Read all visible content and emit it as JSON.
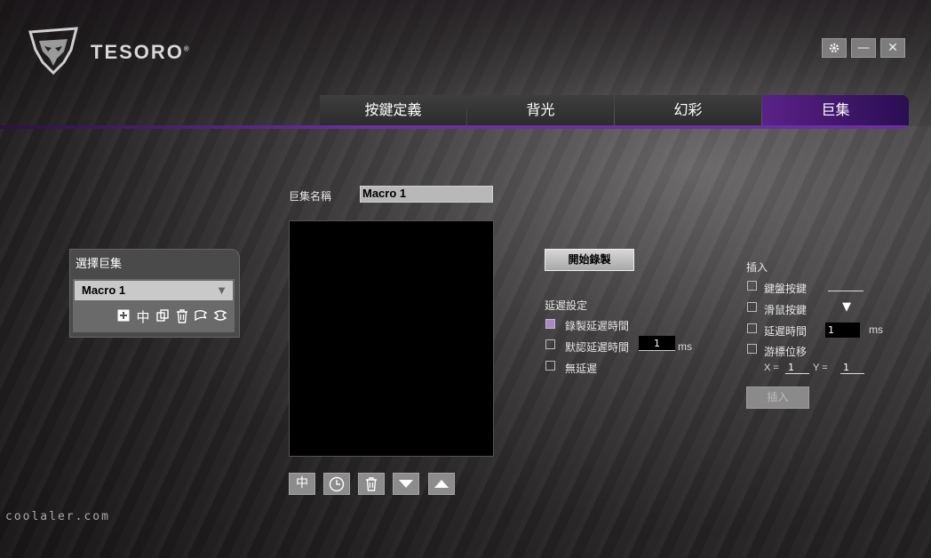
{
  "brand": {
    "name": "TESORO",
    "mark": "®"
  },
  "window": {
    "settings_icon": "gear-icon",
    "minimize_label": "—",
    "close_label": "✕"
  },
  "tabs": [
    {
      "label": "按鍵定義",
      "active": false
    },
    {
      "label": "背光",
      "active": false
    },
    {
      "label": "幻彩",
      "active": false
    },
    {
      "label": "巨集",
      "active": true
    }
  ],
  "colors": {
    "accent": "#6b2fa3",
    "active_tab": "#5a2288",
    "checkbox_checked": "#a88ac2"
  },
  "macro": {
    "name_label": "巨集名稱",
    "name_value": "Macro 1"
  },
  "select_macro": {
    "title": "選擇巨集",
    "selected": "Macro 1",
    "actions": [
      "add-icon",
      "split-icon",
      "copy-icon",
      "trash-icon",
      "import-icon",
      "export-icon"
    ]
  },
  "toolbar": {
    "buttons": [
      "split-icon",
      "clock-icon",
      "trash-icon",
      "move-down-icon",
      "move-up-icon"
    ]
  },
  "record": {
    "button_label": "開始錄製"
  },
  "delay": {
    "title": "延遲設定",
    "options": [
      {
        "label": "錄製延遲時間",
        "checked": true
      },
      {
        "label": "默認延遲時間",
        "checked": false,
        "value": "1",
        "unit": "ms"
      },
      {
        "label": "無延遲",
        "checked": false
      }
    ]
  },
  "insert": {
    "title": "插入",
    "keyboard_label": "鍵盤按鍵",
    "mouse_label": "滑鼠按鍵",
    "delay_label": "延遲時間",
    "delay_value": "1",
    "delay_unit": "ms",
    "cursor_label": "游標位移",
    "x_label": "X =",
    "x_value": "1",
    "y_label": "Y =",
    "y_value": "1",
    "button_label": "插入"
  },
  "watermark": "coolaler.com"
}
